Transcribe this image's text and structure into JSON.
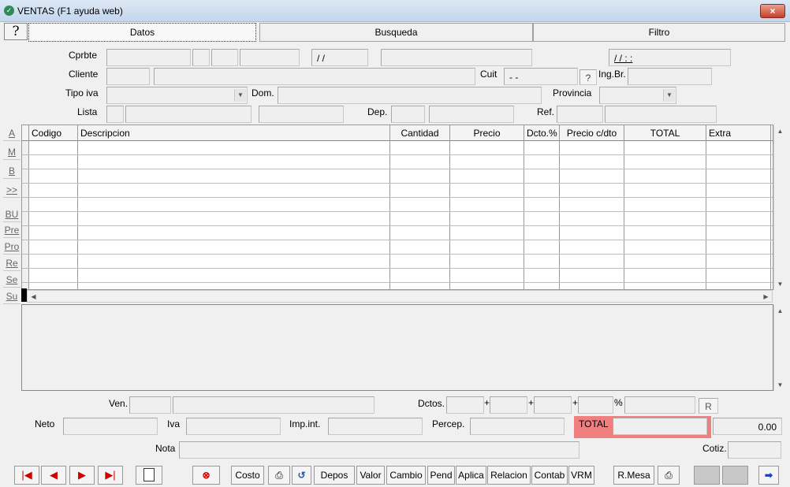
{
  "window": {
    "title": "VENTAS (F1 ayuda web)",
    "close": "×"
  },
  "help": {
    "label": "?"
  },
  "tabs": [
    {
      "label": "Datos"
    },
    {
      "label": "Busqueda"
    },
    {
      "label": "Filtro"
    }
  ],
  "header": {
    "cprbte_label": "Cprbte",
    "cliente_label": "Cliente",
    "tipo_iva_label": "Tipo iva",
    "lista_label": "Lista",
    "dom_label": "Dom.",
    "dep_label": "Dep.",
    "ref_label": "Ref.",
    "cuit_label": "Cuit",
    "cuit_value": "-        -",
    "cuit_help": "?",
    "ingbr_label": "Ing.Br.",
    "provincia_label": "Provincia",
    "date_value": "/ /",
    "datetime_value": "/ /      : :"
  },
  "grid": {
    "columns": [
      "Codigo",
      "Descripcion",
      "Cantidad",
      "Precio",
      "Dcto.%",
      "Precio c/dto",
      "TOTAL",
      "Extra"
    ],
    "row_count": 10
  },
  "sidebar": {
    "buttons": [
      "A",
      "M",
      "B",
      ">>",
      "BU",
      "Pre",
      "Pro",
      "Re",
      "Se",
      "Su"
    ]
  },
  "footer": {
    "ven_label": "Ven.",
    "dctos_label": "Dctos.",
    "plus1": "+",
    "plus2": "+",
    "plus3": "+",
    "percent": "%",
    "r_button": "R",
    "neto_label": "Neto",
    "iva_label": "Iva",
    "impint_label": "Imp.int.",
    "percep_label": "Percep.",
    "total_label": "TOTAL",
    "total_value": "0.00",
    "nota_label": "Nota",
    "cotiz_label": "Cotiz."
  },
  "toolbar": {
    "costo": "Costo",
    "depos": "Depos",
    "valor": "Valor",
    "cambio": "Cambio",
    "pend": "Pend",
    "aplica": "Aplica",
    "relacion": "Relacion",
    "contab": "Contab",
    "vrm": "VRM",
    "rmesa": "R.Mesa"
  },
  "colors": {
    "total_bg": "#f08080"
  }
}
